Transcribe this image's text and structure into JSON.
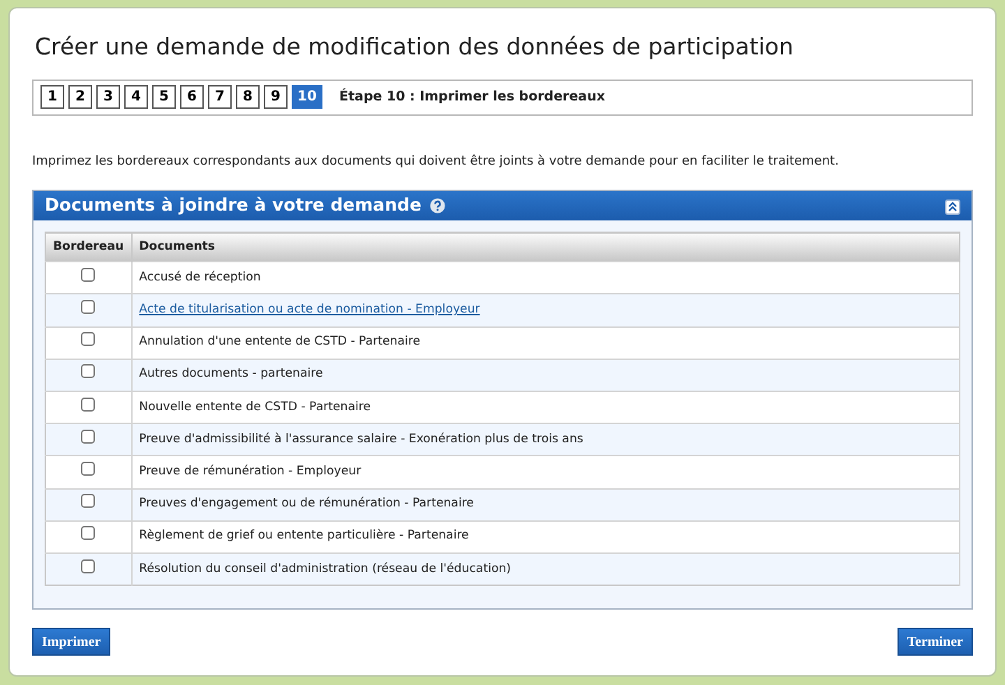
{
  "title": "Créer une demande de modification des données de participation",
  "steps": [
    {
      "label": "1",
      "selected": false
    },
    {
      "label": "2",
      "selected": false
    },
    {
      "label": "3",
      "selected": false
    },
    {
      "label": "4",
      "selected": false
    },
    {
      "label": "5",
      "selected": false
    },
    {
      "label": "6",
      "selected": false
    },
    {
      "label": "7",
      "selected": false
    },
    {
      "label": "8",
      "selected": false
    },
    {
      "label": "9",
      "selected": false
    },
    {
      "label": "10",
      "selected": true
    }
  ],
  "step_title": "Étape 10 : Imprimer les bordereaux",
  "instructions": "Imprimez les bordereaux correspondants aux documents qui doivent être joints à votre demande pour en faciliter le traitement.",
  "panel": {
    "title": "Documents à joindre à votre demande",
    "expanded": true
  },
  "table": {
    "columns": [
      "Bordereau",
      "Documents"
    ],
    "rows": [
      {
        "document": "Accusé de réception",
        "kind": "text",
        "checked": false
      },
      {
        "document": "Acte de titularisation ou acte de nomination - Employeur",
        "kind": "link",
        "checked": false
      },
      {
        "document": "Annulation d'une entente de CSTD - Partenaire",
        "kind": "text",
        "checked": false
      },
      {
        "document": "Autres documents - partenaire",
        "kind": "text",
        "checked": false
      },
      {
        "document": "Nouvelle entente de CSTD - Partenaire",
        "kind": "text",
        "checked": false
      },
      {
        "document": "Preuve d'admissibilité à l'assurance salaire - Exonération plus de trois ans",
        "kind": "text",
        "checked": false
      },
      {
        "document": "Preuve de rémunération - Employeur",
        "kind": "text",
        "checked": false
      },
      {
        "document": "Preuves d'engagement ou de rémunération - Partenaire",
        "kind": "text",
        "checked": false
      },
      {
        "document": "Règlement de grief ou entente particulière - Partenaire",
        "kind": "text",
        "checked": false
      },
      {
        "document": "Résolution du conseil d'administration (réseau de l'éducation)",
        "kind": "text",
        "checked": false
      }
    ]
  },
  "buttons": [
    "Imprimer",
    "Terminer"
  ]
}
